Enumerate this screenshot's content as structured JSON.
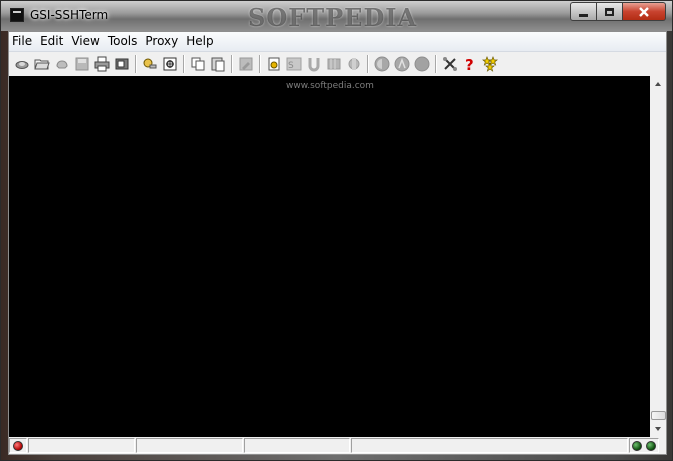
{
  "window": {
    "title": "GSI-SSHTerm",
    "watermark": "SOFTPEDIA",
    "caption_buttons": [
      "minimize",
      "maximize",
      "close"
    ]
  },
  "menubar": {
    "items": [
      "File",
      "Edit",
      "View",
      "Tools",
      "Proxy",
      "Help"
    ]
  },
  "toolbar": {
    "buttons": [
      {
        "name": "connect-icon",
        "enabled": true
      },
      {
        "name": "open-folder-icon",
        "enabled": true
      },
      {
        "name": "disconnect-icon",
        "enabled": false
      },
      {
        "name": "save-icon",
        "enabled": false
      },
      {
        "name": "print-icon",
        "enabled": true
      },
      {
        "name": "print-preview-icon",
        "enabled": true
      },
      {
        "name": "key-refresh-icon",
        "enabled": true
      },
      {
        "name": "plugin-icon",
        "enabled": true
      },
      {
        "name": "copy-icon",
        "enabled": true
      },
      {
        "name": "paste-icon",
        "enabled": true
      },
      {
        "name": "edit-icon",
        "enabled": false
      },
      {
        "name": "lock-icon",
        "enabled": true
      },
      {
        "name": "sftp-icon",
        "enabled": false
      },
      {
        "name": "tunnel-icon",
        "enabled": false
      },
      {
        "name": "terminal-icon",
        "enabled": false
      },
      {
        "name": "session-icon",
        "enabled": false
      },
      {
        "name": "record-icon",
        "enabled": false
      },
      {
        "name": "stop-icon",
        "enabled": false
      },
      {
        "name": "pause-icon",
        "enabled": false
      },
      {
        "name": "tools-icon",
        "enabled": true
      },
      {
        "name": "help-icon",
        "enabled": true
      },
      {
        "name": "about-icon",
        "enabled": true
      }
    ]
  },
  "terminal": {
    "background": "#000000",
    "watermark_site": "www.softpedia.com"
  },
  "statusbar": {
    "left_led": "red",
    "right_leds": [
      "green",
      "green"
    ]
  }
}
